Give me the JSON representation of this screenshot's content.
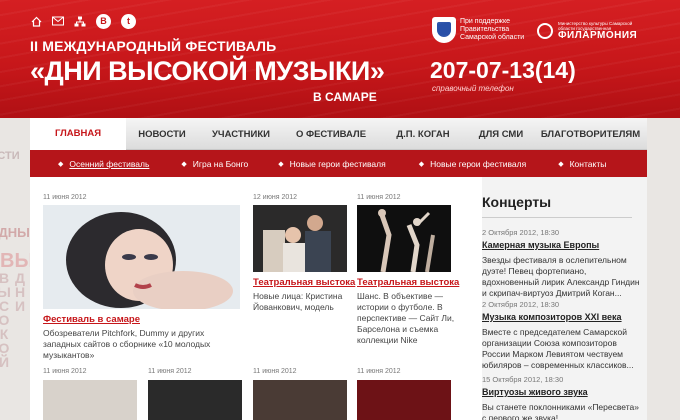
{
  "side": {
    "left_t1": "ЕСТИ",
    "left_t2": "РОДНЫЙ",
    "left_t3": "ВЫ",
    "left_vertical": "ДНИ ВЫСОКОЙ"
  },
  "header": {
    "icons": [
      "home-icon",
      "mail-icon",
      "sitemap-icon",
      "vk-icon",
      "twitter-icon"
    ],
    "vk_glyph": "В",
    "tw_glyph": "t",
    "title_line1": "II МЕЖДУНАРОДНЫЙ ФЕСТИВАЛЬ",
    "title_line2": "«ДНИ ВЫСОКОЙ МУЗЫКИ»",
    "title_line3": "В САМАРЕ",
    "phone": "207-07-13(14)",
    "phone_label": "справочный телефон",
    "gov_text": "При поддержке Правительства Самарской области",
    "phil_small": "Министерство культуры Самарской области государственная",
    "phil_name": "ФИЛАРМОНИЯ"
  },
  "nav": {
    "items": [
      "ГЛАВНАЯ",
      "НОВОСТИ",
      "УЧАСТНИКИ",
      "О ФЕСТИВАЛЕ",
      "Д.П. КОГАН",
      "ДЛЯ СМИ",
      "БЛАГОТВОРИТЕЛЯМ"
    ],
    "active_index": 0
  },
  "subnav": {
    "items": [
      "Осенний фестиваль",
      "Игра на Бонго",
      "Новые герои фестиваля",
      "Новые герои фестиваля",
      "Контакты"
    ],
    "active_index": 0
  },
  "news": {
    "featured": {
      "date": "11 июня 2012",
      "title": "Фестиваль в самаре",
      "text": "Обозреватели Pitchfork, Dummy и других западных сайтов о сборнике «10 молодых музыкантов»"
    },
    "items": [
      {
        "date": "12 июня 2012",
        "title": "Театральная выстока",
        "text": "Новые лица: Кристина Йованкович, модель"
      },
      {
        "date": "11 июня 2012",
        "title": "Театральная выстока",
        "text": "Шанс. В объективе — истории о футболе. В перспективе — Сайт Ли, Барселона и съемка коллекции Nike"
      }
    ],
    "bottom_dates": [
      "11 июня 2012",
      "11 июня 2012",
      "11 июня 2012",
      "11 июня 2012"
    ]
  },
  "sidebar": {
    "title": "Концерты",
    "events": [
      {
        "date": "2 Октября 2012, 18:30",
        "title": "Камерная музыка Европы",
        "text": "Звезды фестиваля в ослепительном дуэте! Певец фортепиано, вдохновенный лирик Александр Гиндин и скрипач-виртуоз Дмитрий Коган..."
      },
      {
        "date": "2 Октября 2012, 18:30",
        "title": "Музыка композиторов XXI века",
        "text": "Вместе с председателем Самарской организации Союза композиторов России Марком Левиятом чествуем юбиляров – современных классиков..."
      },
      {
        "date": "15 Октября 2012, 18:30",
        "title": "Виртуозы живого звука",
        "text": "Вы станете поклонниками «Пересвета» с первого же звука!"
      }
    ]
  },
  "colors": {
    "brand_red": "#c6161a",
    "subnav_red": "#b5151a"
  }
}
